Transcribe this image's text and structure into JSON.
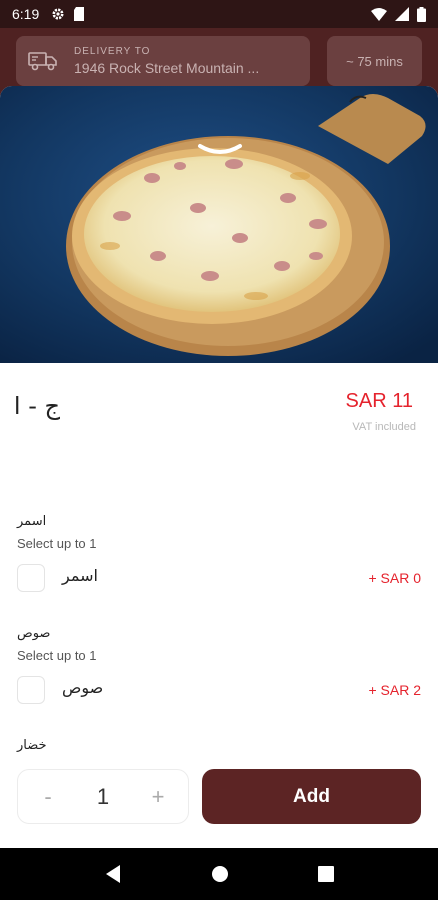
{
  "status_bar": {
    "time": "6:19"
  },
  "header": {
    "delivery_label": "DELIVERY TO",
    "delivery_address": "1946 Rock Street Mountain ...",
    "delivery_time": "~ 75 mins"
  },
  "product": {
    "title": "ج - ا",
    "price": "SAR 11",
    "vat_note": "VAT included"
  },
  "groups": [
    {
      "title": "اسمر",
      "subtitle": "Select up to 1",
      "option_label": "اسمر",
      "option_price": "+  SAR 0"
    },
    {
      "title": "صوص",
      "subtitle": "Select up to 1",
      "option_label": "صوص",
      "option_price": "+  SAR 2"
    },
    {
      "title": "خضار"
    }
  ],
  "cart": {
    "minus": "-",
    "quantity": "1",
    "plus": "+",
    "add_label": "Add"
  },
  "colors": {
    "brand": "#5c2424",
    "price_red": "#e5232d",
    "header_bg": "#4f2222"
  }
}
